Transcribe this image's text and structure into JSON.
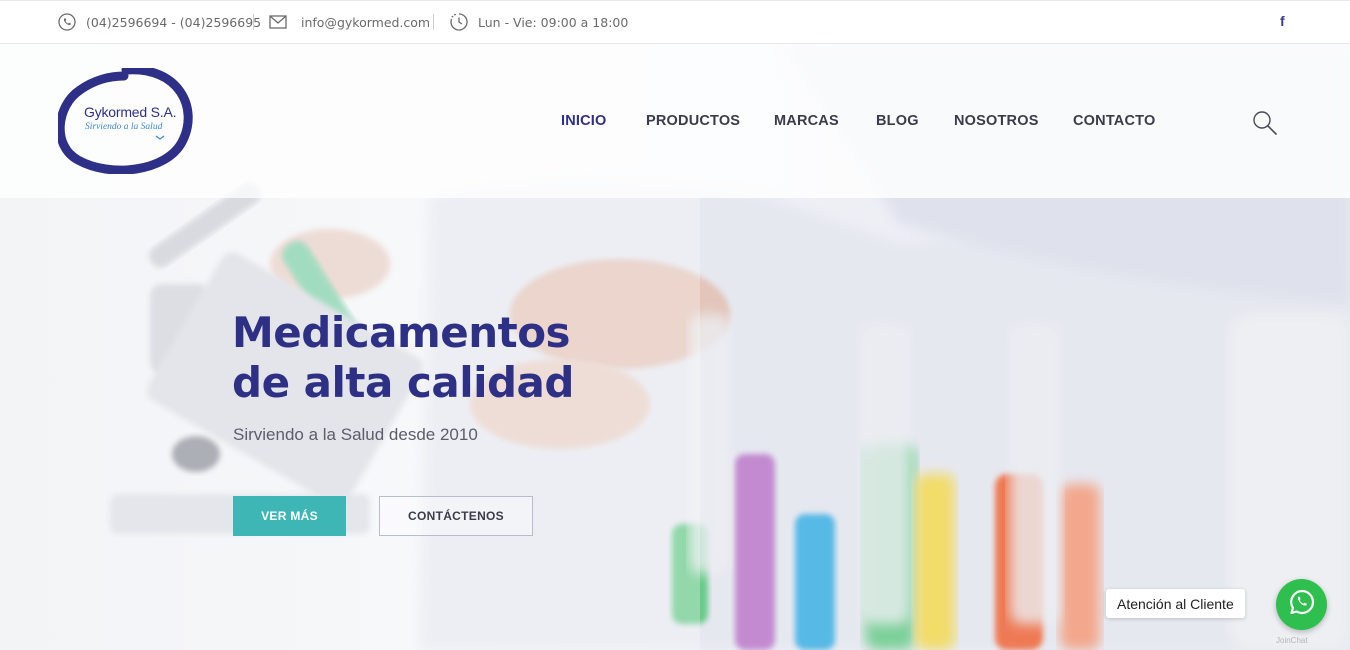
{
  "topbar": {
    "phone": "(04)2596694 - (04)2596695",
    "email": "info@gykormed.com",
    "hours": "Lun - Vie: 09:00 a 18:00",
    "social": "f",
    "icons": [
      "phone-icon",
      "mail-icon",
      "clock-icon",
      "facebook-icon"
    ]
  },
  "logo": {
    "name": "Gykormed S.A.",
    "tagline": "Sirviendo a la Salud"
  },
  "nav": {
    "items": [
      "INICIO",
      "PRODUCTOS",
      "MARCAS",
      "BLOG",
      "NOSOTROS",
      "CONTACTO"
    ],
    "active": "INICIO"
  },
  "hero": {
    "headline_line1": "Medicamentos",
    "headline_line2": "de alta calidad",
    "subtitle": "Sirviendo a la Salud desde 2010",
    "primary_button": "VER MÁS",
    "secondary_button": "CONTÁCTENOS"
  },
  "whatsapp": {
    "label": "Atención al Cliente",
    "footer": "JoinChat"
  },
  "colors": {
    "brand_navy": "#2e3085",
    "accent_teal": "#3fb6b6",
    "whatsapp_green": "#2fbf4f"
  }
}
